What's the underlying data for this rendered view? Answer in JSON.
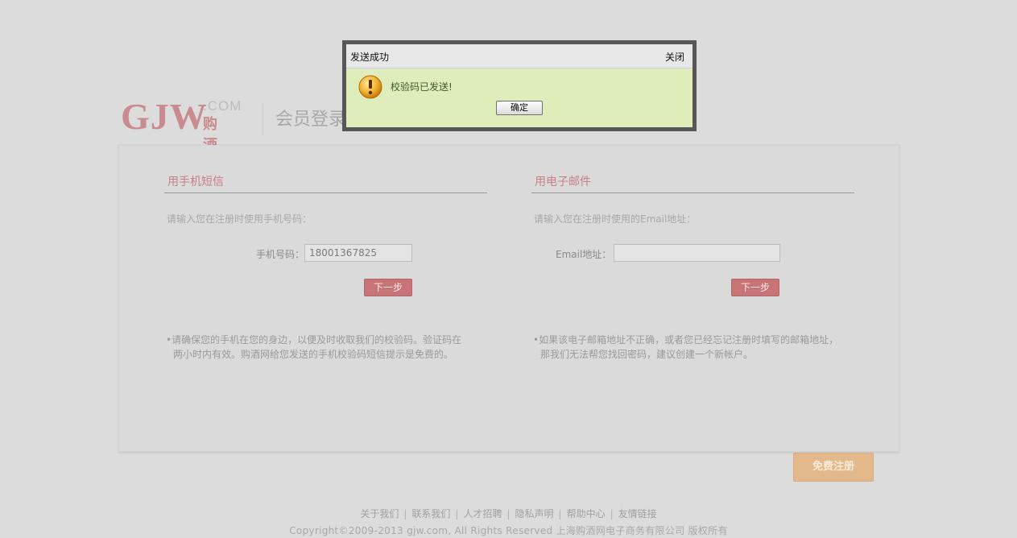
{
  "logo": {
    "brand": "GJW",
    "domain": ".COM",
    "brand_cn": "购酒网"
  },
  "page_title": "会员登录",
  "phone": {
    "title": "用手机短信",
    "hint": "请输入您在注册时使用手机号码：",
    "field_label": "手机号码：",
    "field_value": "18001367825",
    "next_label": "下一步",
    "note_line1": "•请确保您的手机在您的身边，以便及时收取我们的校验码。验证码在",
    "note_line2": "两小时内有效。购酒网给您发送的手机校验码短信提示是免费的。"
  },
  "email": {
    "title": "用电子邮件",
    "hint": "请输入您在注册时使用的Email地址：",
    "field_label": "Email地址：",
    "field_value": "",
    "next_label": "下一步",
    "note_line1": "•如果该电子邮箱地址不正确，或者您已经忘记注册时填写的邮箱地址，",
    "note_line2": "那我们无法帮您找回密码，建议创建一个新帐户。"
  },
  "register_label": "免费注册",
  "footer": {
    "links": [
      "关于我们",
      "联系我们",
      "人才招聘",
      "隐私声明",
      "帮助中心",
      "友情链接"
    ],
    "copyright": "Copyright©2009-2013 gjw.com, All Rights Reserved 上海购酒网电子商务有限公司 版权所有"
  },
  "dialog": {
    "title": "发送成功",
    "close_label": "关闭",
    "message": "校验码已发送!",
    "ok_label": "确定",
    "icon": "warning-icon"
  },
  "colors": {
    "accent": "#c87477",
    "register": "#e3b98c",
    "dialog_body": "#dfedbb",
    "background": "#dcdcdc"
  }
}
